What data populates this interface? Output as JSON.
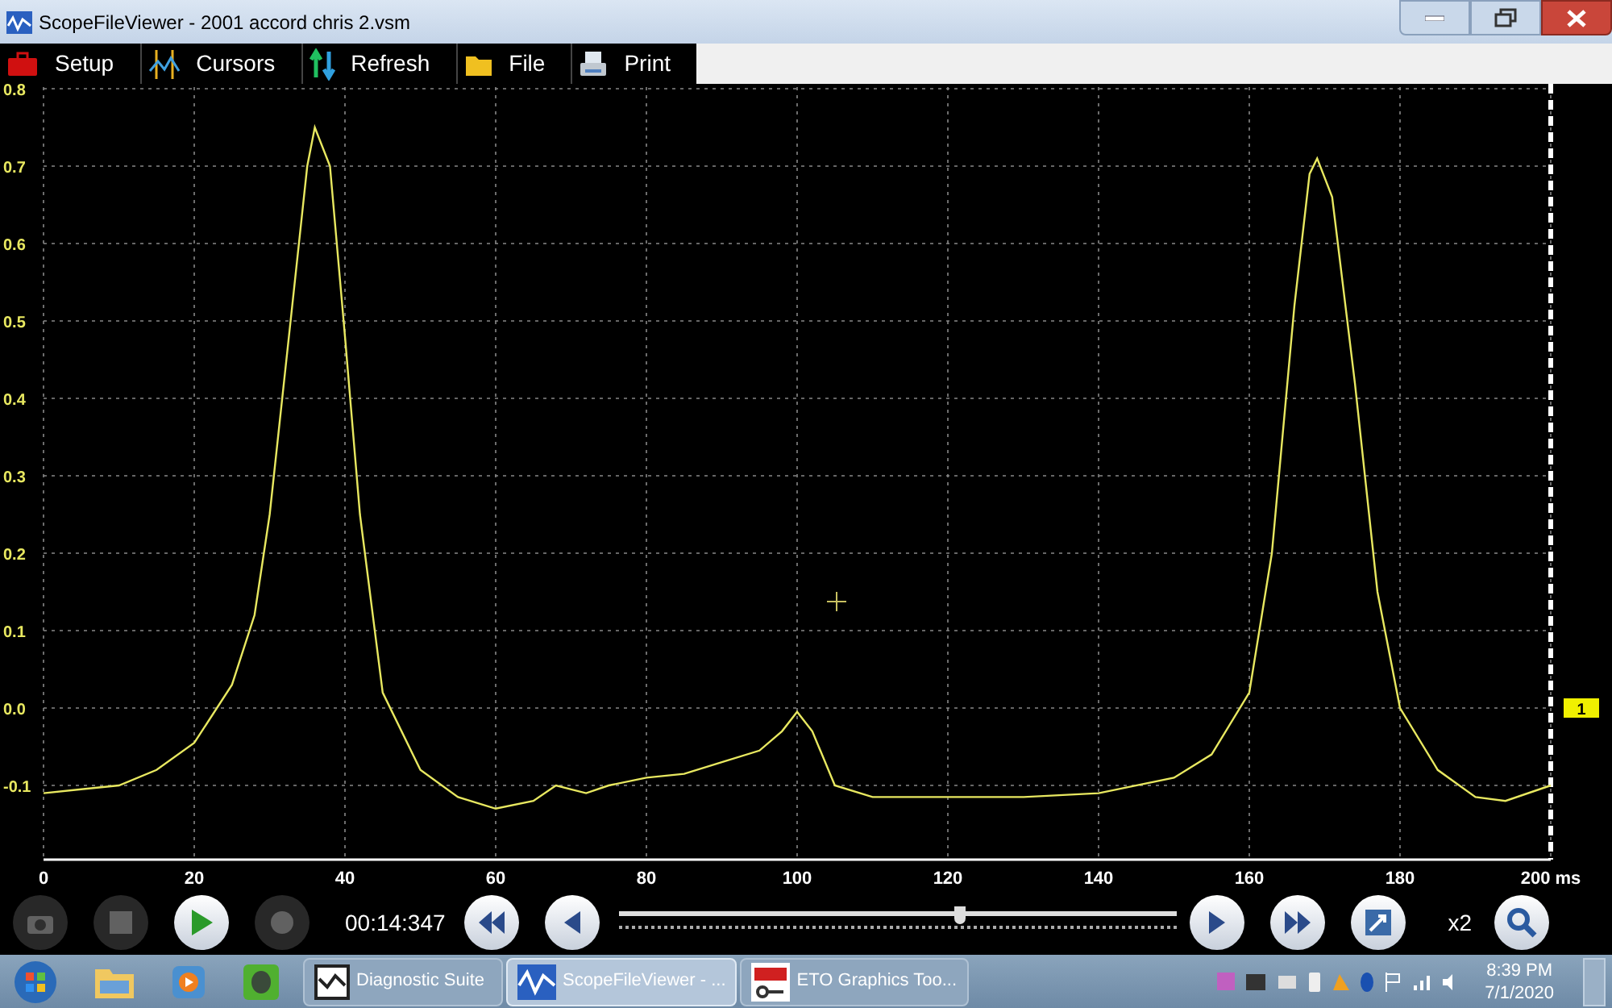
{
  "window": {
    "title": "ScopeFileViewer - 2001 accord chris 2.vsm"
  },
  "toolbar": [
    {
      "kind": "setup",
      "label": "Setup"
    },
    {
      "kind": "cursors",
      "label": "Cursors"
    },
    {
      "kind": "refresh",
      "label": "Refresh"
    },
    {
      "kind": "file",
      "label": "File"
    },
    {
      "kind": "print",
      "label": "Print"
    }
  ],
  "scope": {
    "chart_data": {
      "type": "line",
      "grid": true,
      "xlim": [
        0,
        200
      ],
      "ylim": [
        -0.2,
        0.8
      ],
      "xticks": [
        0,
        20,
        40,
        60,
        80,
        100,
        120,
        140,
        160,
        180,
        {
          "value": 200,
          "label": "200 ms"
        }
      ],
      "yticks": [
        {
          "value": -0.1,
          "label": "-0.1"
        },
        {
          "value": 0,
          "label": "0.0"
        },
        {
          "value": 0.1,
          "label": "0.1"
        },
        {
          "value": 0.2,
          "label": "0.2"
        },
        {
          "value": 0.3,
          "label": "0.3"
        },
        {
          "value": 0.4,
          "label": "0.4"
        },
        {
          "value": 0.5,
          "label": "0.5"
        },
        {
          "value": 0.6,
          "label": "0.6"
        },
        {
          "value": 0.7,
          "label": "0.7"
        },
        {
          "value": 0.8,
          "label": "0.8"
        }
      ],
      "x": [
        0,
        5,
        10,
        15,
        20,
        25,
        28,
        30,
        33,
        35,
        36,
        38,
        40,
        42,
        45,
        50,
        55,
        60,
        65,
        68,
        70,
        72,
        75,
        80,
        85,
        90,
        95,
        98,
        100,
        102,
        105,
        110,
        120,
        130,
        140,
        150,
        155,
        160,
        163,
        166,
        168,
        169,
        171,
        174,
        177,
        180,
        185,
        190,
        194,
        200
      ],
      "series": [
        {
          "name": "1",
          "color": "#e8e860",
          "values": [
            -0.11,
            -0.105,
            -0.1,
            -0.08,
            -0.045,
            0.03,
            0.12,
            0.25,
            0.52,
            0.7,
            0.75,
            0.7,
            0.48,
            0.25,
            0.02,
            -0.08,
            -0.115,
            -0.13,
            -0.12,
            -0.1,
            -0.105,
            -0.11,
            -0.1,
            -0.09,
            -0.085,
            -0.07,
            -0.055,
            -0.03,
            -0.005,
            -0.03,
            -0.1,
            -0.115,
            -0.115,
            -0.115,
            -0.11,
            -0.09,
            -0.06,
            0.02,
            0.2,
            0.52,
            0.69,
            0.71,
            0.66,
            0.42,
            0.15,
            0.0,
            -0.08,
            -0.115,
            -0.12,
            -0.1
          ]
        }
      ]
    }
  },
  "controls": {
    "buttons": [
      {
        "kind": "camera",
        "disabled": true
      },
      {
        "kind": "stop",
        "disabled": true
      },
      {
        "kind": "play",
        "disabled": false
      },
      {
        "kind": "record",
        "disabled": true
      }
    ],
    "time": "00:14:347",
    "slider": {
      "level": 0.61
    },
    "zoom_label": "x2"
  },
  "taskbar": {
    "pinned": [
      {
        "kind": "explorer"
      },
      {
        "kind": "media"
      },
      {
        "kind": "notes"
      }
    ],
    "windows": [
      {
        "kind": "diag",
        "label": "Diagnostic Suite",
        "selected": false
      },
      {
        "kind": "scope",
        "label": "ScopeFileViewer - ...",
        "selected": true
      },
      {
        "kind": "eto",
        "label": "ETO Graphics Too...",
        "selected": false
      }
    ],
    "clock": {
      "time": "8:39 PM",
      "date": "7/1/2020"
    }
  }
}
